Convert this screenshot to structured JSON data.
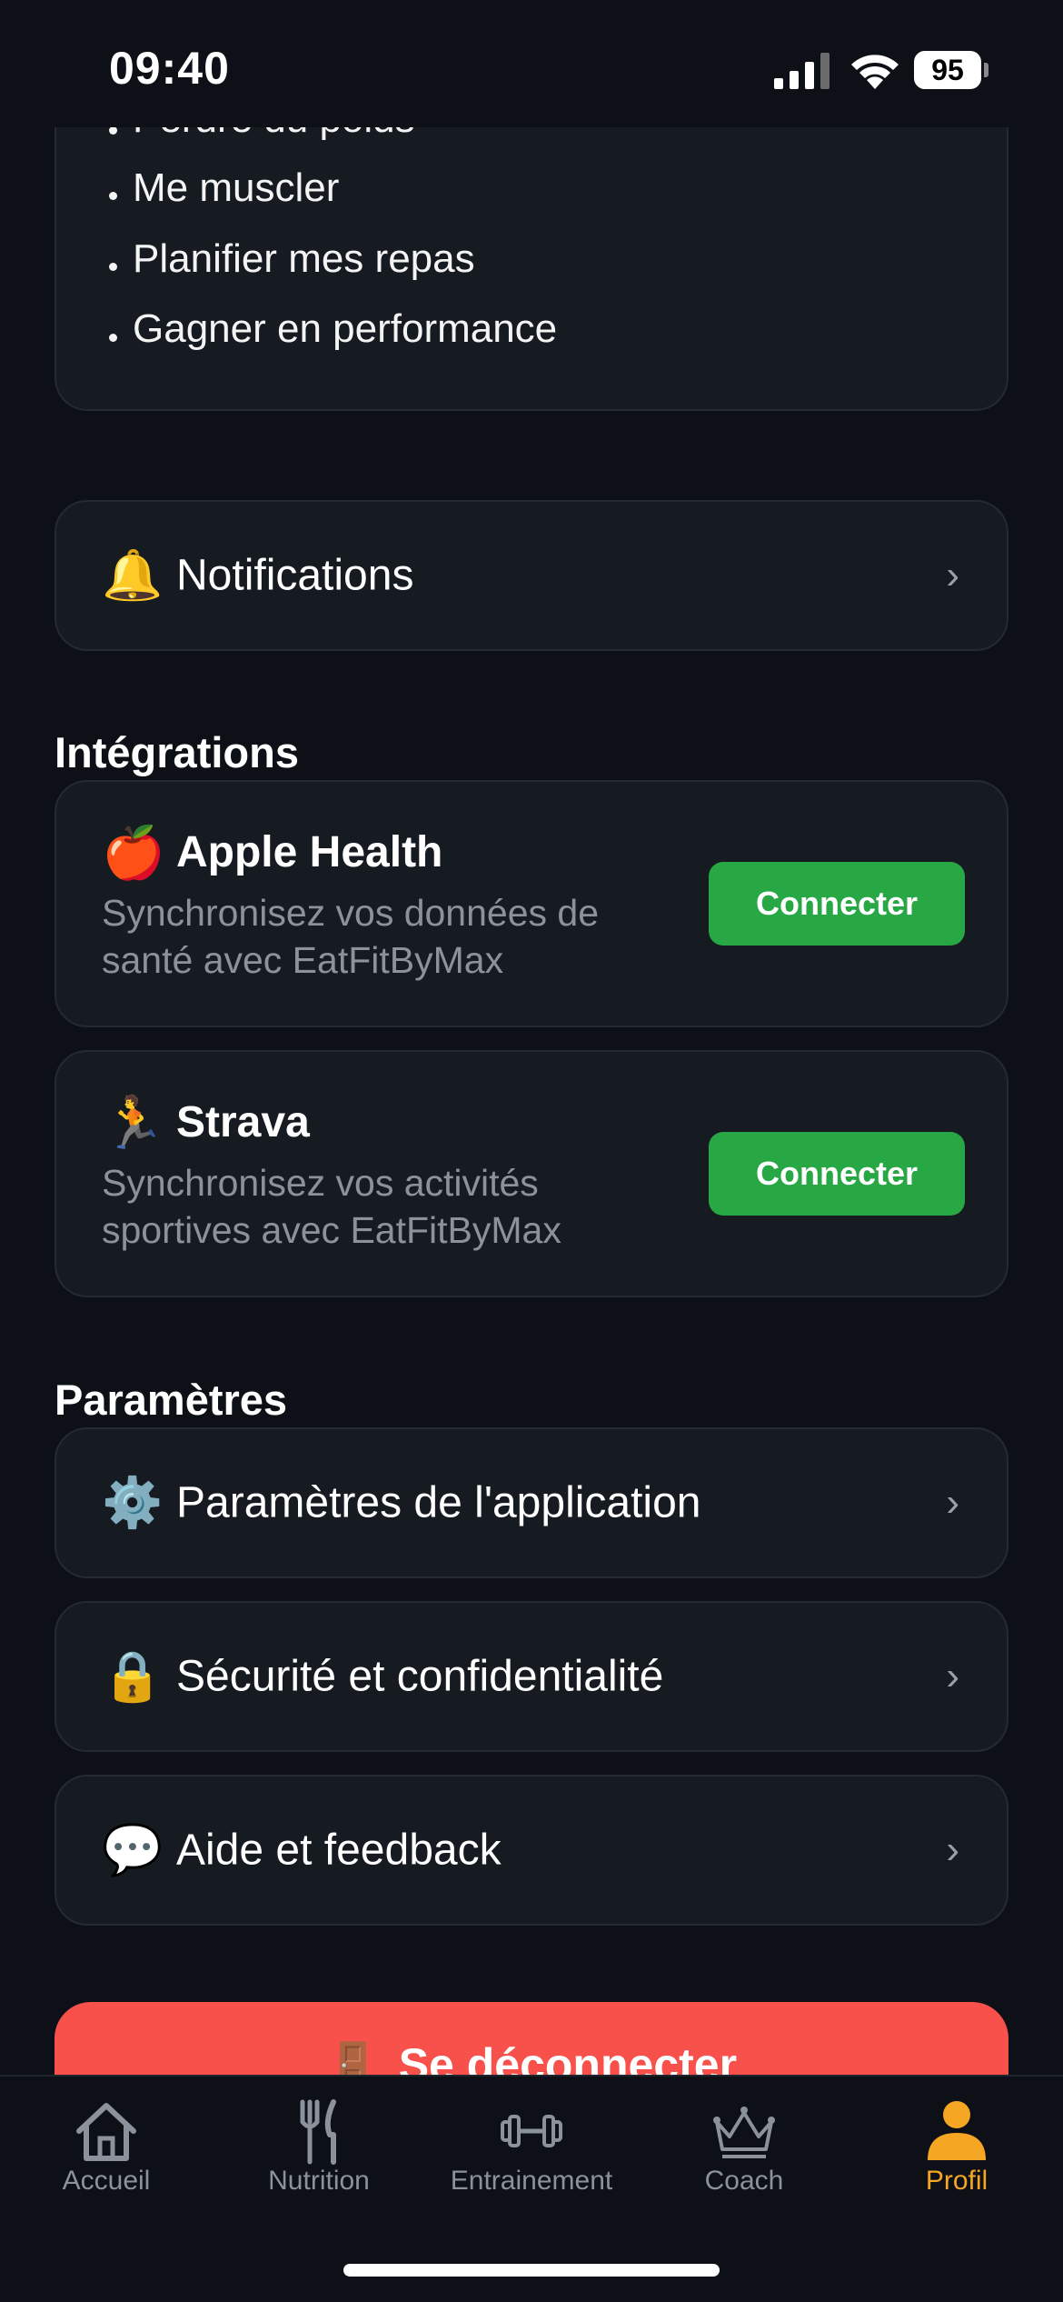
{
  "status_bar": {
    "time": "09:40",
    "battery": "95"
  },
  "goals": {
    "items": [
      "Perdre du poids",
      "Me muscler",
      "Planifier mes repas",
      "Gagner en performance"
    ]
  },
  "notifications": {
    "icon": "🔔",
    "label": "Notifications",
    "chevron": "›"
  },
  "integrations": {
    "title": "Intégrations",
    "items": [
      {
        "icon": "🍎",
        "name": "Apple Health",
        "description": "Synchronisez vos données de santé avec EatFitByMax",
        "button": "Connecter"
      },
      {
        "icon": "🏃",
        "name": "Strava",
        "description": "Synchronisez vos activités sportives avec EatFitByMax",
        "button": "Connecter"
      }
    ]
  },
  "settings": {
    "title": "Paramètres",
    "items": [
      {
        "icon": "⚙️",
        "label": "Paramètres de l'application",
        "chevron": "›"
      },
      {
        "icon": "🔒",
        "label": "Sécurité et confidentialité",
        "chevron": "›"
      },
      {
        "icon": "💬",
        "label": "Aide et feedback",
        "chevron": "›"
      }
    ]
  },
  "logout": {
    "icon": "🚪",
    "label": "Se déconnecter"
  },
  "tab_bar": {
    "tabs": [
      {
        "label": "Accueil",
        "icon": "home-icon"
      },
      {
        "label": "Nutrition",
        "icon": "fork-knife-icon"
      },
      {
        "label": "Entrainement",
        "icon": "dumbbell-icon"
      },
      {
        "label": "Coach",
        "icon": "crown-icon"
      },
      {
        "label": "Profil",
        "icon": "person-icon"
      }
    ],
    "active": "Profil",
    "active_color": "#f5a623",
    "inactive_color": "#8b929b"
  },
  "colors": {
    "background": "#0d1117",
    "card": "#161b22",
    "connect": "#28a745",
    "logout": "#f8514c"
  }
}
